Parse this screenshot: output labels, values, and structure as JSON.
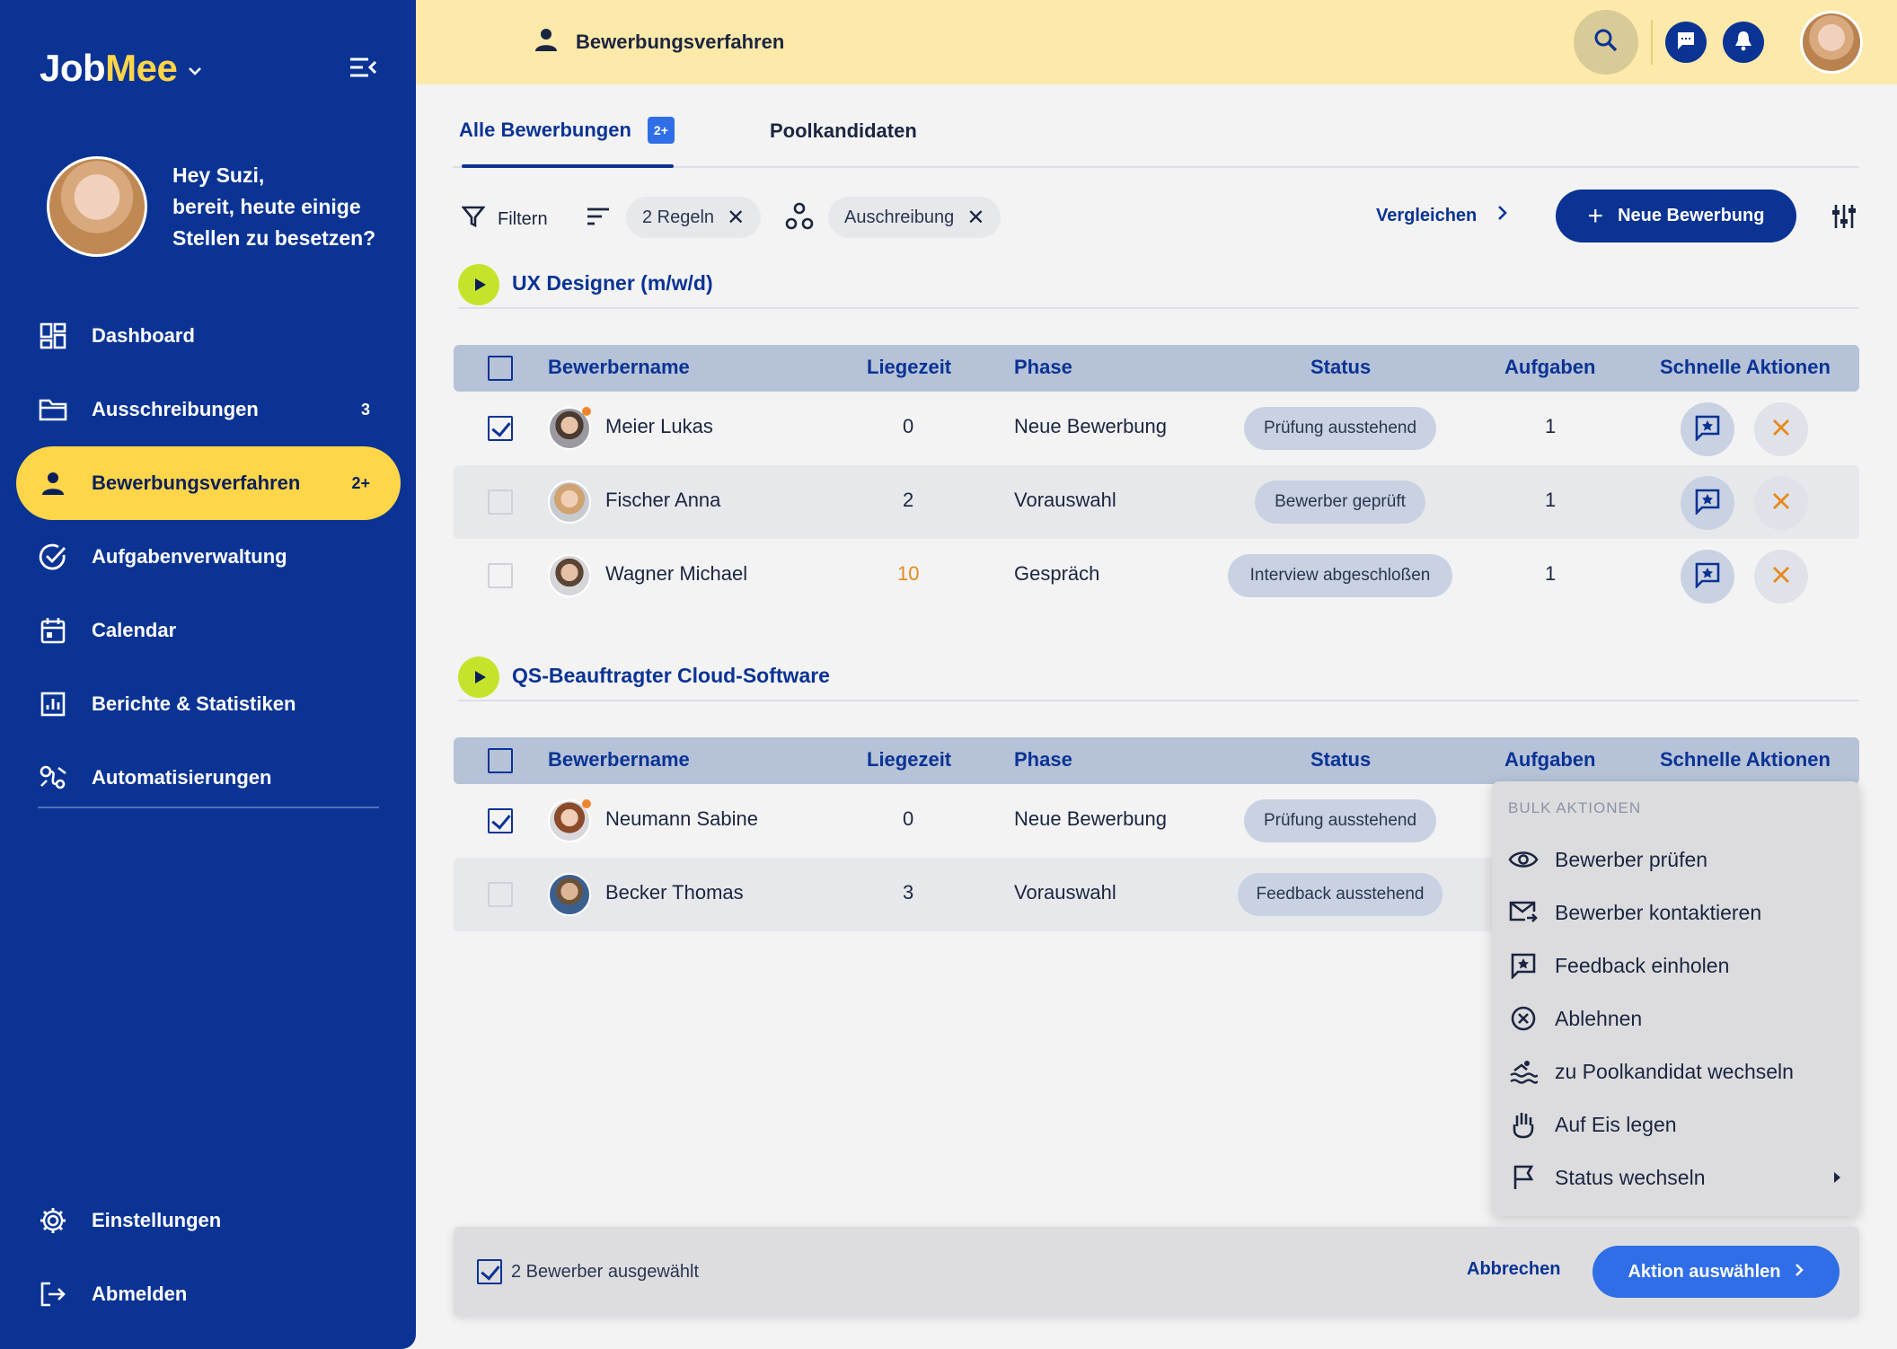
{
  "brand": {
    "part1": "Job",
    "part2": "Mee"
  },
  "greeting": {
    "line1": "Hey Suzi,",
    "line2": "bereit, heute einige",
    "line3": "Stellen zu besetzen?"
  },
  "nav": [
    {
      "label": "Dashboard",
      "icon": "dashboard-icon",
      "count": ""
    },
    {
      "label": "Ausschreibungen",
      "icon": "folder-icon",
      "count": "3"
    },
    {
      "label": "Bewerbungsverfahren",
      "icon": "person-icon",
      "count": "2+"
    },
    {
      "label": "Aufgabenverwaltung",
      "icon": "check-circle-icon",
      "count": ""
    },
    {
      "label": "Calendar",
      "icon": "calendar-icon",
      "count": ""
    },
    {
      "label": "Berichte & Statistiken",
      "icon": "report-icon",
      "count": ""
    },
    {
      "label": "Automatisierungen",
      "icon": "automation-icon",
      "count": ""
    }
  ],
  "nav_bottom": [
    {
      "label": "Einstellungen",
      "icon": "gear-icon"
    },
    {
      "label": "Abmelden",
      "icon": "logout-icon"
    }
  ],
  "topbar": {
    "title": "Bewerbungsverfahren"
  },
  "tabs": [
    {
      "label": "Alle Bewerbungen",
      "badge": "2+"
    },
    {
      "label": "Poolkandidaten"
    }
  ],
  "filters": {
    "filter_label": "Filtern",
    "rules_chip": "2 Regeln",
    "tender_chip": "Auschreibung",
    "compare_label": "Vergleichen",
    "new_button": "Neue Bewerbung"
  },
  "columns": {
    "name": "Bewerbername",
    "time": "Liegezeit",
    "phase": "Phase",
    "status": "Status",
    "tasks": "Aufgaben",
    "quick": "Schnelle Aktionen"
  },
  "groups": [
    {
      "title": "UX Designer (m/w/d)",
      "rows": [
        {
          "name": "Meier Lukas",
          "time": "0",
          "phase": "Neue Bewerbung",
          "status": "Prüfung ausstehend",
          "tasks": "1",
          "checked": true,
          "new": true
        },
        {
          "name": "Fischer Anna",
          "time": "2",
          "phase": "Vorauswahl",
          "status": "Bewerber geprüft",
          "tasks": "1",
          "checked": false,
          "new": false
        },
        {
          "name": "Wagner Michael",
          "time": "10",
          "phase": "Gespräch",
          "status": "Interview abgeschloßen",
          "tasks": "1",
          "checked": false,
          "new": false
        }
      ]
    },
    {
      "title": "QS-Beauftragter Cloud-Software",
      "rows": [
        {
          "name": "Neumann Sabine",
          "time": "0",
          "phase": "Neue Bewerbung",
          "status": "Prüfung ausstehend",
          "checked": true,
          "new": true
        },
        {
          "name": "Becker Thomas",
          "time": "3",
          "phase": "Vorauswahl",
          "status": "Feedback ausstehend",
          "checked": false,
          "new": false
        }
      ]
    }
  ],
  "bulk_menu": {
    "title": "BULK AKTIONEN",
    "items": [
      {
        "label": "Bewerber prüfen",
        "icon": "eye-icon"
      },
      {
        "label": "Bewerber kontaktieren",
        "icon": "mail-forward-icon"
      },
      {
        "label": "Feedback einholen",
        "icon": "feedback-star-icon"
      },
      {
        "label": "Ablehnen",
        "icon": "cancel-circle-icon"
      },
      {
        "label": "zu Poolkandidat wechseln",
        "icon": "pool-icon"
      },
      {
        "label": "Auf Eis legen",
        "icon": "hand-icon"
      },
      {
        "label": "Status wechseln",
        "icon": "flag-icon"
      }
    ]
  },
  "action_bar": {
    "selected": "2 Bewerber ausgewählt",
    "cancel": "Abbrechen",
    "choose": "Aktion auswählen"
  },
  "colors": {
    "primary": "#0a3394",
    "accent": "#ffd54a",
    "topbar": "#fde9a9",
    "play": "#c6e32c",
    "button_blue": "#2f6ee6",
    "warning": "#e8891c"
  }
}
